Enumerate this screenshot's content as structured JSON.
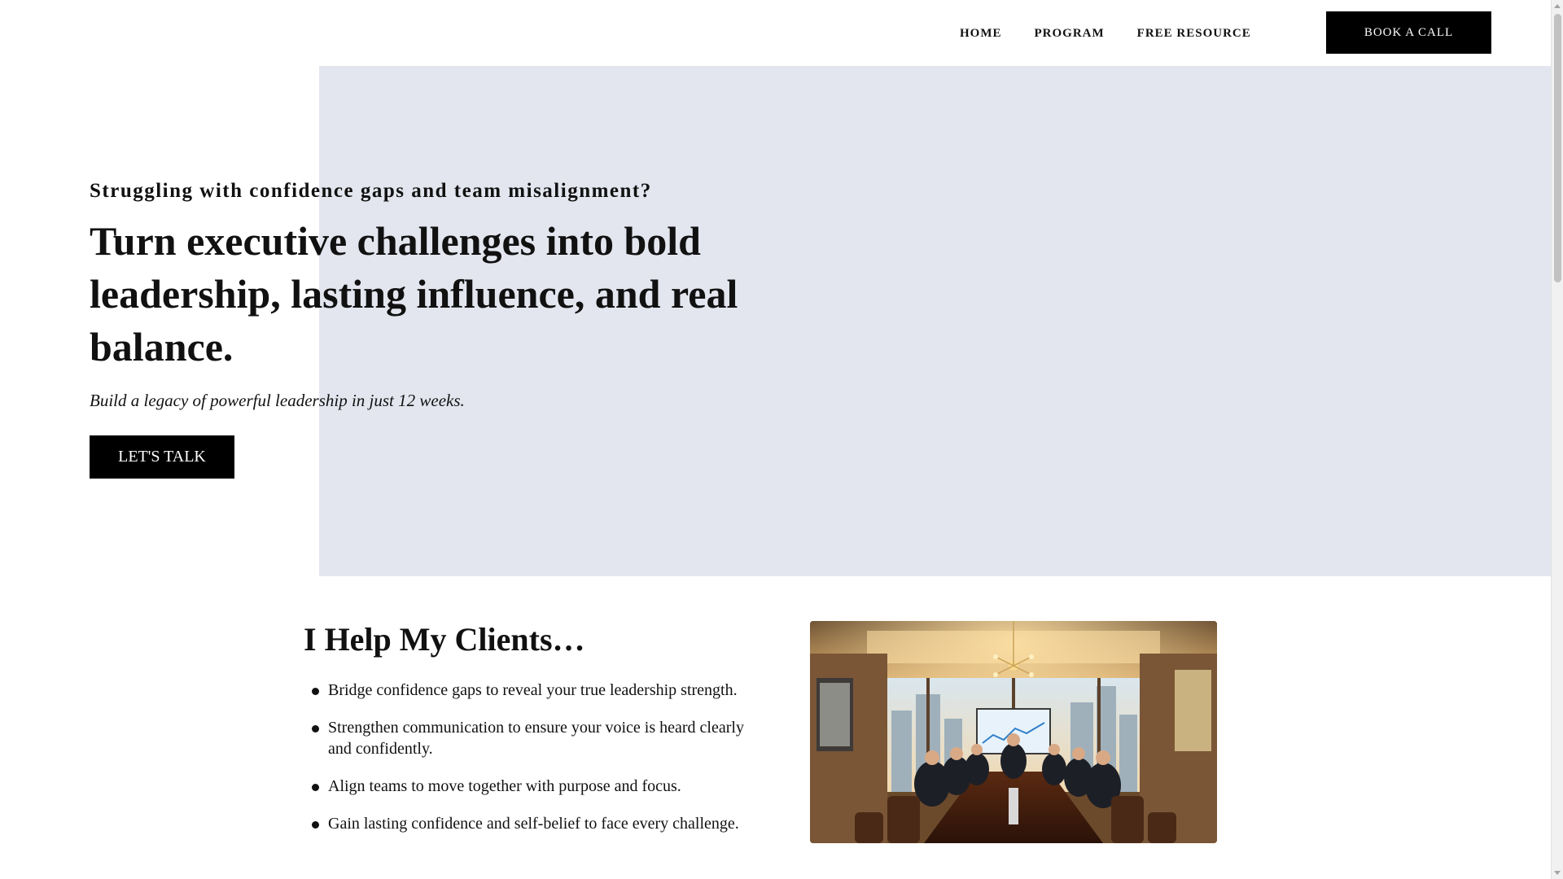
{
  "nav": {
    "links": [
      "HOME",
      "PROGRAM",
      "FREE RESOURCE"
    ],
    "book_button": "BOOK A CALL"
  },
  "hero": {
    "eyebrow": "Struggling with confidence gaps and team misalignment?",
    "title": "Turn executive challenges into bold leadership, lasting influence, and real balance.",
    "subtitle": "Build a legacy of powerful leadership in just 12 weeks.",
    "cta_label": "LET'S TALK",
    "background_color": "#e3e6ee"
  },
  "clients": {
    "title_prefix": "I Help My ",
    "title_bold": "Clients",
    "title_suffix": "…",
    "items": [
      "Bridge confidence gaps to reveal your true leadership strength.",
      "Strengthen communication to ensure your voice is heard clearly and confidently.",
      "Align teams to move together with purpose and focus.",
      "Gain lasting confidence and self-belief to face every challenge."
    ]
  },
  "photo": {
    "subject": "executive-meeting-boardroom-photo"
  },
  "colors": {
    "button": "#000000",
    "button_text": "#ffffff",
    "text": "#111111"
  }
}
